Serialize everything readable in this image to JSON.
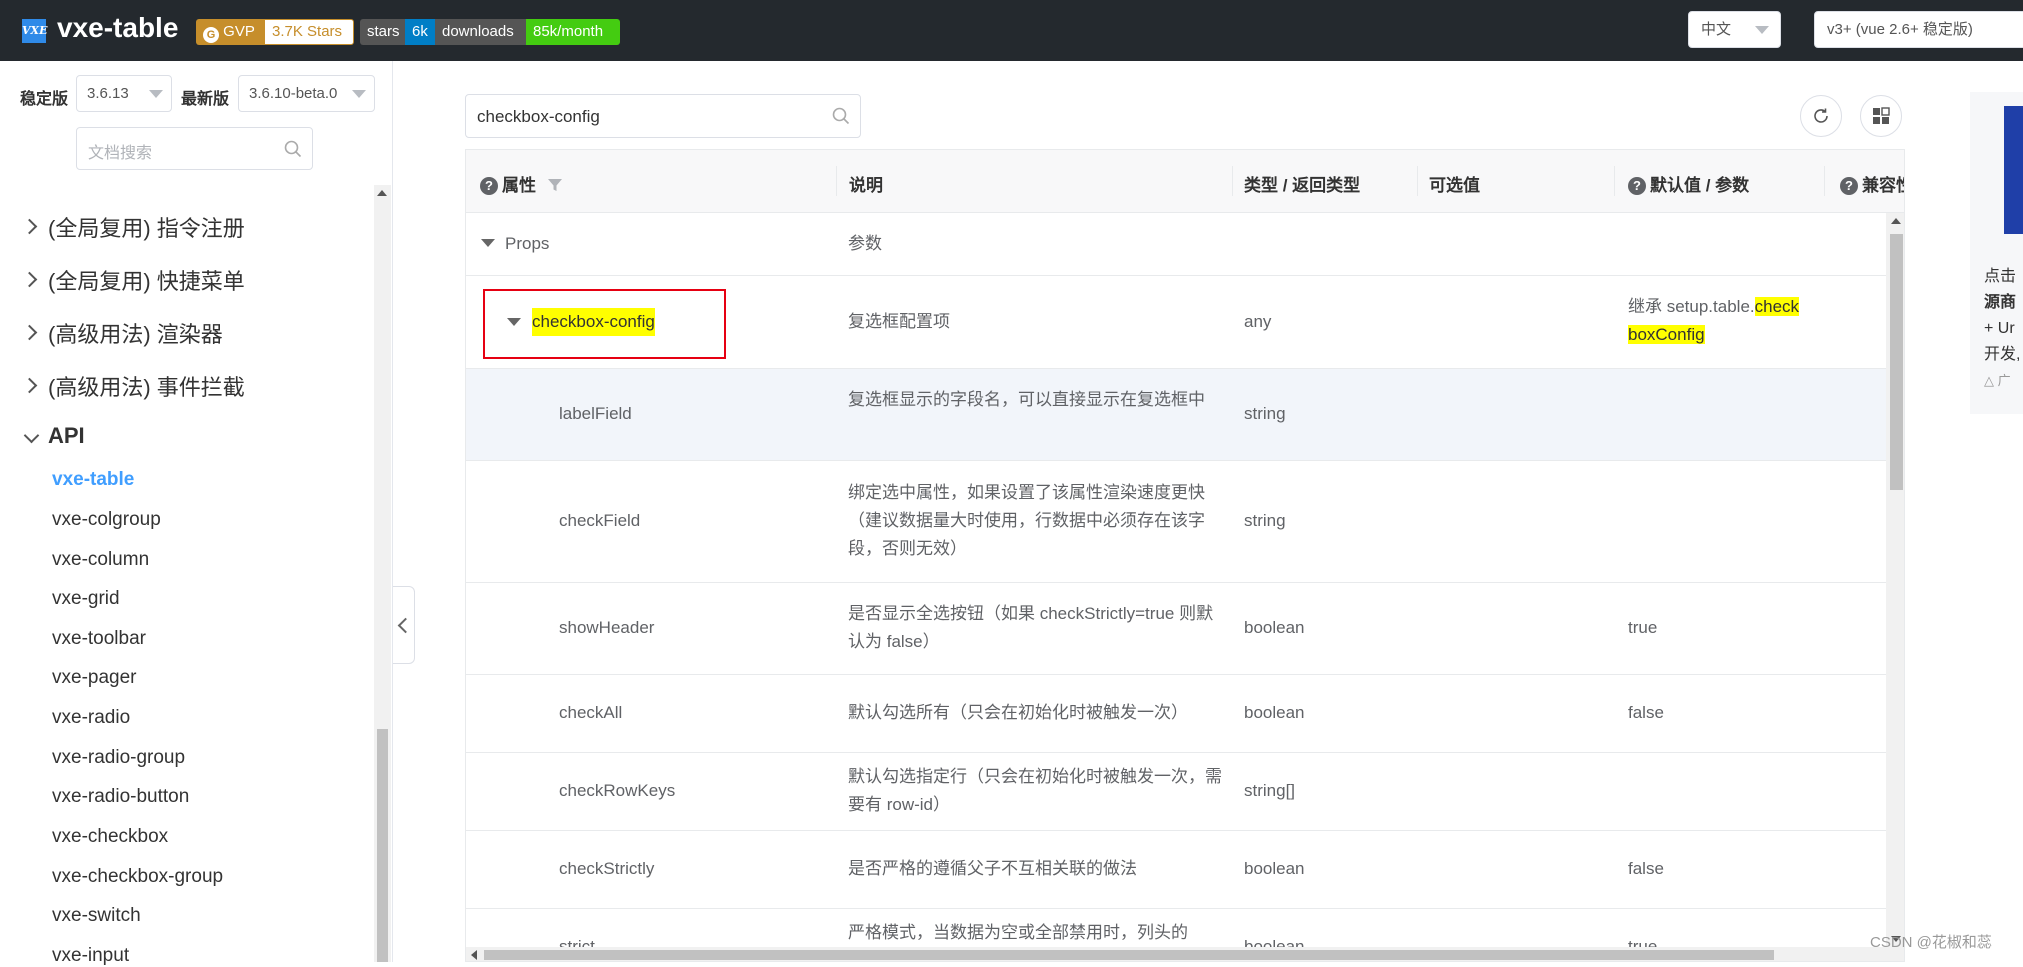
{
  "header": {
    "logo_text": "VXE",
    "app_title": "vxe-table",
    "badges": {
      "gvp": "GVP",
      "stars": "3.7K Stars",
      "gh_label": "stars",
      "gh_count": "6k",
      "dl_label": "downloads",
      "dl_count": "85k/month"
    },
    "language": "中文",
    "version_select": "v3+ (vue 2.6+ 稳定版)"
  },
  "sidebar": {
    "stable_label": "稳定版",
    "stable_value": "3.6.13",
    "latest_label": "最新版",
    "latest_value": "3.6.10-beta.0",
    "search_placeholder": "文档搜索",
    "groups": [
      "(全局复用) 指令注册",
      "(全局复用) 快捷菜单",
      "(高级用法) 渲染器",
      "(高级用法) 事件拦截"
    ],
    "api_label": "API",
    "api_items": [
      "vxe-table",
      "vxe-colgroup",
      "vxe-column",
      "vxe-grid",
      "vxe-toolbar",
      "vxe-pager",
      "vxe-radio",
      "vxe-radio-group",
      "vxe-radio-button",
      "vxe-checkbox",
      "vxe-checkbox-group",
      "vxe-switch",
      "vxe-input"
    ]
  },
  "content": {
    "search_value": "checkbox-config",
    "columns": [
      "属性",
      "说明",
      "类型 / 返回类型",
      "可选值",
      "默认值 / 参数",
      "兼容性"
    ],
    "props_group": "Props",
    "props_desc": "参数",
    "main_row": {
      "name": "checkbox-config",
      "desc": "复选框配置项",
      "type": "any",
      "default_prefix": "继承 setup.table.",
      "default_hl1": "check",
      "default_hl2": "boxConfig"
    },
    "rows": [
      {
        "name": "labelField",
        "desc": "复选框显示的字段名，可以直接显示在复选框中",
        "type": "string",
        "default": ""
      },
      {
        "name": "checkField",
        "desc": "绑定选中属性，如果设置了该属性渲染速度更快（建议数据量大时使用，行数据中必须存在该字段，否则无效）",
        "type": "string",
        "default": ""
      },
      {
        "name": "showHeader",
        "desc": "是否显示全选按钮（如果 checkStrictly=true 则默认为 false）",
        "type": "boolean",
        "default": "true"
      },
      {
        "name": "checkAll",
        "desc": "默认勾选所有（只会在初始化时被触发一次）",
        "type": "boolean",
        "default": "false"
      },
      {
        "name": "checkRowKeys",
        "desc": "默认勾选指定行（只会在初始化时被触发一次，需要有 row-id）",
        "type": "string[]",
        "default": ""
      },
      {
        "name": "checkStrictly",
        "desc": "是否严格的遵循父子不互相关联的做法",
        "type": "boolean",
        "default": "false"
      },
      {
        "name": "strict",
        "desc": "严格模式，当数据为空或全部禁用时，列头的",
        "type": "boolean",
        "default": "true"
      }
    ]
  },
  "ad": {
    "line1": "点击",
    "line2": "源商",
    "line3": "+ Ur",
    "line4": "开发,",
    "line5": "△ 广"
  },
  "watermark": "CSDN @花椒和蕊",
  "colors": {
    "header_bg": "#24292e",
    "accent": "#409eff",
    "highlight": "#ffff00",
    "red_box": "#e60012"
  }
}
